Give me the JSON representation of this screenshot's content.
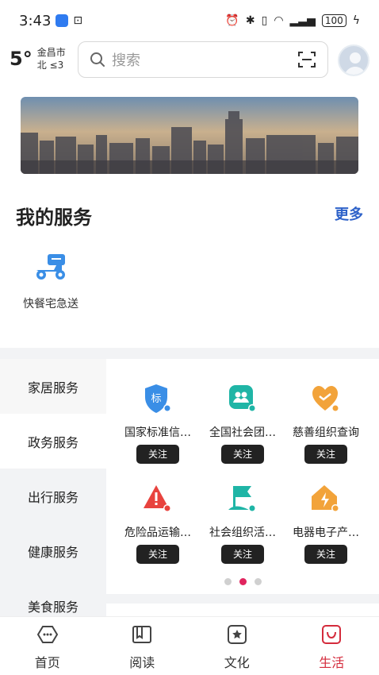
{
  "status_bar": {
    "time": "3:43",
    "battery": "100"
  },
  "weather": {
    "temp": "5°",
    "city": "金昌市",
    "wind": "北 ≤3"
  },
  "search": {
    "placeholder": "搜索"
  },
  "my_services": {
    "title": "我的服务",
    "more": "更多",
    "items": [
      {
        "label": "快餐宅急送",
        "icon": "delivery-scooter-icon"
      }
    ]
  },
  "categories": [
    {
      "label": "家居服务"
    },
    {
      "label": "政务服务"
    },
    {
      "label": "出行服务"
    },
    {
      "label": "健康服务"
    },
    {
      "label": "美食服务"
    }
  ],
  "services": [
    {
      "name": "国家标准信…",
      "icon": "standard-shield-icon",
      "follow": "关注"
    },
    {
      "name": "全国社会团…",
      "icon": "social-group-icon",
      "follow": "关注"
    },
    {
      "name": "慈善组织查询",
      "icon": "charity-heart-icon",
      "follow": "关注"
    },
    {
      "name": "危险品运输…",
      "icon": "hazard-warning-icon",
      "follow": "关注"
    },
    {
      "name": "社会组织活…",
      "icon": "organization-flag-icon",
      "follow": "关注"
    },
    {
      "name": "电器电子产…",
      "icon": "electric-house-icon",
      "follow": "关注"
    }
  ],
  "pager": {
    "count": 3,
    "active": 2
  },
  "bottom_nav": [
    {
      "label": "首页",
      "icon": "home-icon"
    },
    {
      "label": "阅读",
      "icon": "book-icon"
    },
    {
      "label": "文化",
      "icon": "culture-star-icon"
    },
    {
      "label": "生活",
      "icon": "life-bag-icon",
      "active": true
    }
  ],
  "colors": {
    "accent": "#d42b3c",
    "link": "#2e62c9",
    "blue_icon": "#3a8ee6",
    "teal_icon": "#1fb5a6",
    "orange_icon": "#f2a33a",
    "red_icon": "#e8433e"
  }
}
